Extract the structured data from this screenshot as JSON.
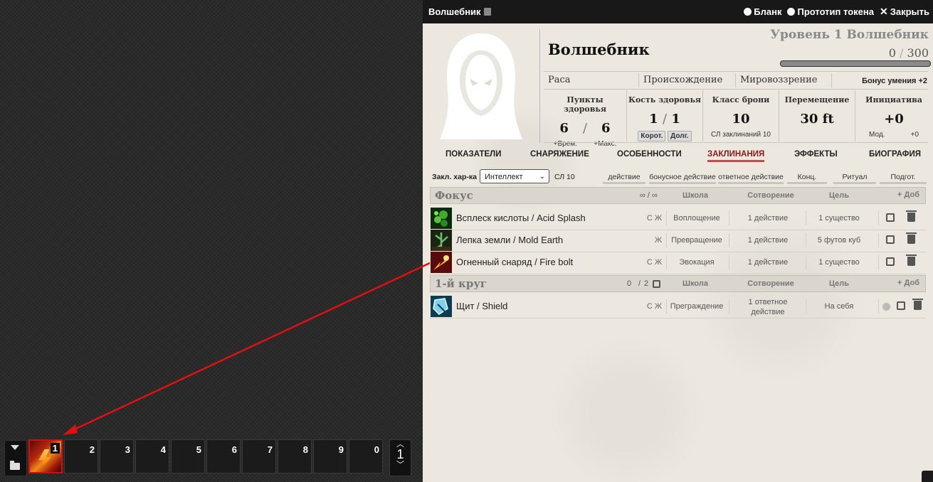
{
  "window": {
    "title": "Волшебник",
    "actions": [
      {
        "label": "Бланк",
        "icon": "gear-icon"
      },
      {
        "label": "Прототип токена",
        "icon": "user-circle-icon"
      },
      {
        "label": "Закрыть",
        "icon": "close-icon"
      }
    ]
  },
  "character": {
    "name": "Волшебник",
    "level_text": "Уровень 1 Волшебник",
    "xp_current": "0",
    "xp_sep": "/",
    "xp_max": "300",
    "xp_progress": 0,
    "race": "Раса",
    "background": "Происхождение",
    "alignment": "Мировоззрение",
    "proficiency": "Бонус умения +2"
  },
  "stats": {
    "hp": {
      "label": "Пункты здоровья",
      "current": "6",
      "sep": "/",
      "max": "6",
      "temp": "+Врем.",
      "maxmod": "+Макс."
    },
    "hit_dice": {
      "label": "Кость здоровья",
      "current": "1",
      "sep": "/",
      "max": "1",
      "short": "Корот.",
      "long": "Долг."
    },
    "ac": {
      "label": "Класс брони",
      "value": "10",
      "sub": "СЛ заклинаний 10"
    },
    "speed": {
      "label": "Перемещение",
      "value": "30 ft"
    },
    "initiative": {
      "label": "Инициатива",
      "value": "+0",
      "mod_label": "Мод.",
      "mod_value": "+0"
    }
  },
  "tabs": [
    {
      "label": "ПОКАЗАТЕЛИ",
      "active": false
    },
    {
      "label": "СНАРЯЖЕНИЕ",
      "active": false
    },
    {
      "label": "ОСОБЕННОСТИ",
      "active": false
    },
    {
      "label": "ЗАКЛИНАНИЯ",
      "active": true
    },
    {
      "label": "ЭФФЕКТЫ",
      "active": false
    },
    {
      "label": "БИОГРАФИЯ",
      "active": false
    }
  ],
  "filters": {
    "ability_label": "Закл. хар-ка",
    "ability_value": "Интеллект",
    "dc": "СЛ 10",
    "buttons": [
      "действие",
      "бонусное действие",
      "ответное действие",
      "Конц.",
      "Ритуал",
      "Подгот."
    ]
  },
  "sections": [
    {
      "name": "Фокус",
      "slots": "∞ / ∞",
      "columns": [
        "Школа",
        "Сотворение",
        "Цель"
      ],
      "add": "+ Доб",
      "spells": [
        {
          "name": "Всплеск кислоты / Acid Splash",
          "components": "С Ж",
          "school": "Воплощение",
          "casting": "1 действие",
          "target": "1 существо",
          "icon": "acid-splash-icon"
        },
        {
          "name": "Лепка земли / Mold Earth",
          "components": "Ж",
          "school": "Превращение",
          "casting": "1 действие",
          "target": "5 футов куб",
          "icon": "mold-earth-icon"
        },
        {
          "name": "Огненный снаряд / Fire bolt",
          "components": "С Ж",
          "school": "Эвокация",
          "casting": "1 действие",
          "target": "1 существо",
          "icon": "fire-bolt-icon"
        }
      ]
    },
    {
      "name": "1-й круг",
      "slots_current": "0",
      "slots_sep": "/",
      "slots_max": "2",
      "columns": [
        "Школа",
        "Сотворение",
        "Цель"
      ],
      "add": "+ Доб",
      "spells": [
        {
          "name": "Щит / Shield",
          "components": "С Ж",
          "school": "Преграждение",
          "casting": "1 ответное действие",
          "target": "На себя",
          "icon": "shield-spell-icon"
        }
      ]
    }
  ],
  "hotbar": {
    "slots": [
      "1",
      "2",
      "3",
      "4",
      "5",
      "6",
      "7",
      "8",
      "9",
      "0"
    ],
    "page": "1"
  },
  "colors": {
    "accent": "#c84b4b",
    "arrow": "#e01010",
    "titlebar": "#181818"
  }
}
